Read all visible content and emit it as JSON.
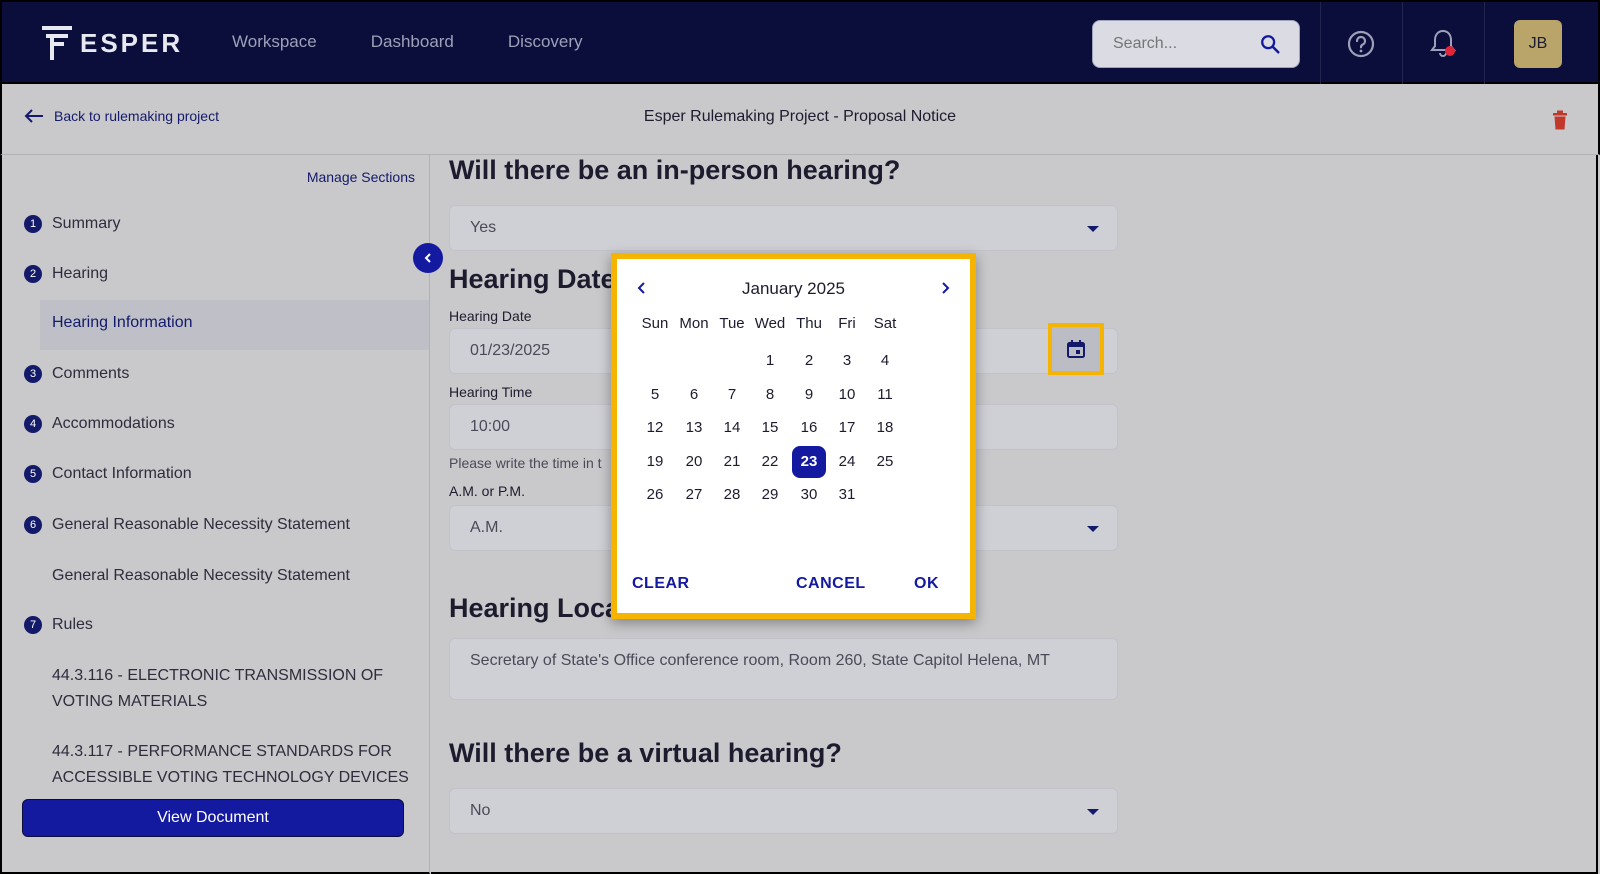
{
  "nav": {
    "brand": "ESPER",
    "links": [
      "Workspace",
      "Dashboard",
      "Discovery"
    ],
    "search_placeholder": "Search...",
    "avatar_initials": "JB"
  },
  "subheader": {
    "back_label": "Back to rulemaking project",
    "title": "Esper Rulemaking Project - Proposal Notice"
  },
  "sidebar": {
    "manage_sections": "Manage Sections",
    "items": [
      {
        "num": "1",
        "label": "Summary"
      },
      {
        "num": "2",
        "label": "Hearing"
      },
      {
        "num": "3",
        "label": "Comments"
      },
      {
        "num": "4",
        "label": "Accommodations"
      },
      {
        "num": "5",
        "label": "Contact Information"
      },
      {
        "num": "6",
        "label": "General Reasonable Necessity Statement"
      },
      {
        "num": "7",
        "label": "Rules"
      }
    ],
    "active_sub": "Hearing Information",
    "sub_items": [
      "General Reasonable Necessity Statement",
      "44.3.116 - ELECTRONIC TRANSMISSION OF VOTING MATERIALS",
      "44.3.117 - PERFORMANCE STANDARDS FOR ACCESSIBLE VOTING TECHNOLOGY DEVICES"
    ],
    "view_document": "View Document"
  },
  "form": {
    "in_person_question": "Will there be an in-person hearing?",
    "in_person_value": "Yes",
    "hearing_date_heading": "Hearing Date",
    "hearing_date_label": "Hearing Date",
    "hearing_date_value": "01/23/2025",
    "hearing_time_label": "Hearing Time",
    "hearing_time_value": "10:00",
    "time_hint": "Please write the time in t",
    "ampm_label": "A.M. or P.M.",
    "ampm_value": "A.M.",
    "location_heading": "Hearing Location",
    "location_value": "Secretary of State's Office conference room, Room 260, State Capitol Helena, MT",
    "virtual_question": "Will there be a virtual hearing?",
    "virtual_value": "No"
  },
  "datepicker": {
    "month_label": "January 2025",
    "weekdays": [
      "Sun",
      "Mon",
      "Tue",
      "Wed",
      "Thu",
      "Fri",
      "Sat"
    ],
    "first_weekday_index": 3,
    "days_in_month": 31,
    "selected_day": 23,
    "clear_label": "CLEAR",
    "cancel_label": "CANCEL",
    "ok_label": "OK"
  },
  "colors": {
    "nav_bg": "#0b0e3a",
    "accent": "#141aa0",
    "highlight": "#f5b400",
    "notification_dot": "#e0263b",
    "trash": "#c0392b",
    "avatar_bg": "#b9a56a"
  }
}
